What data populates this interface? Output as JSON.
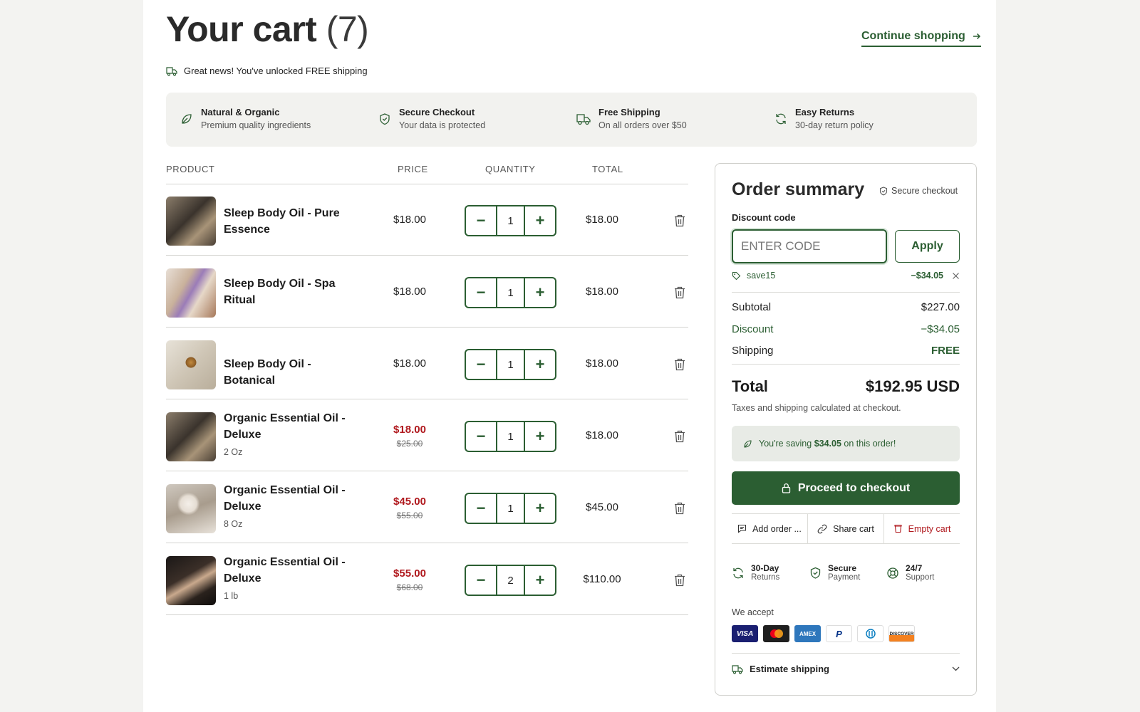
{
  "header": {
    "title": "Your cart",
    "count": "(7)",
    "continue_label": "Continue shopping",
    "free_shipping_msg": "Great news! You've unlocked FREE shipping"
  },
  "features": [
    {
      "icon": "leaf-icon",
      "title": "Natural & Organic",
      "subtitle": "Premium quality ingredients"
    },
    {
      "icon": "shield-icon",
      "title": "Secure Checkout",
      "subtitle": "Your data is protected"
    },
    {
      "icon": "truck-icon",
      "title": "Free Shipping",
      "subtitle": "On all orders over $50"
    },
    {
      "icon": "refresh-icon",
      "title": "Easy Returns",
      "subtitle": "30-day return policy"
    }
  ],
  "table": {
    "headers": {
      "product": "PRODUCT",
      "price": "PRICE",
      "quantity": "QUANTITY",
      "total": "TOTAL"
    }
  },
  "items": [
    {
      "name": "Sleep Body Oil - Pure Essence",
      "variant": "",
      "price": "$18.00",
      "original_price": "",
      "quantity": "1",
      "total": "$18.00"
    },
    {
      "name": "Sleep Body Oil - Spa Ritual",
      "variant": "",
      "price": "$18.00",
      "original_price": "",
      "quantity": "1",
      "total": "$18.00"
    },
    {
      "name": "Sleep Body Oil - Botanical",
      "variant": "",
      "price": "$18.00",
      "original_price": "",
      "quantity": "1",
      "total": "$18.00"
    },
    {
      "name": "Organic Essential Oil - Deluxe",
      "variant": "2 Oz",
      "price": "$18.00",
      "original_price": "$25.00",
      "quantity": "1",
      "total": "$18.00"
    },
    {
      "name": "Organic Essential Oil - Deluxe",
      "variant": "8 Oz",
      "price": "$45.00",
      "original_price": "$55.00",
      "quantity": "1",
      "total": "$45.00"
    },
    {
      "name": "Organic Essential Oil - Deluxe",
      "variant": "1 lb",
      "price": "$55.00",
      "original_price": "$68.00",
      "quantity": "2",
      "total": "$110.00"
    }
  ],
  "qty_controls": {
    "minus": "−",
    "plus": "+"
  },
  "summary": {
    "title": "Order summary",
    "secure_label": "Secure checkout",
    "discount_label": "Discount code",
    "discount_placeholder": "ENTER CODE",
    "apply_label": "Apply",
    "applied_code": "save15",
    "applied_amount": "−$34.05",
    "subtotal_label": "Subtotal",
    "subtotal_value": "$227.00",
    "discount_row_label": "Discount",
    "discount_row_value": "−$34.05",
    "shipping_label": "Shipping",
    "shipping_value": "FREE",
    "total_label": "Total",
    "total_value": "$192.95 USD",
    "taxes_note": "Taxes and shipping calculated at checkout.",
    "saving_prefix": "You're saving",
    "saving_amount": "$34.05",
    "saving_suffix": "on this order!",
    "checkout_label": "Proceed to checkout",
    "actions": {
      "note": "Add order ...",
      "share": "Share cart",
      "empty": "Empty cart"
    },
    "trust": [
      {
        "icon": "refresh-icon",
        "title": "30-Day",
        "subtitle": "Returns"
      },
      {
        "icon": "shield-check-icon",
        "title": "Secure",
        "subtitle": "Payment"
      },
      {
        "icon": "lifebuoy-icon",
        "title": "24/7",
        "subtitle": "Support"
      }
    ],
    "we_accept": "We accept",
    "payment_methods": [
      "VISA",
      "mastercard",
      "AMEX",
      "PayPal",
      "Diners",
      "DISCOVER"
    ],
    "estimate_label": "Estimate shipping"
  },
  "colors": {
    "brand_green": "#2b5e32",
    "sale_red": "#b0191e",
    "panel_bg": "#f2f2ef"
  }
}
